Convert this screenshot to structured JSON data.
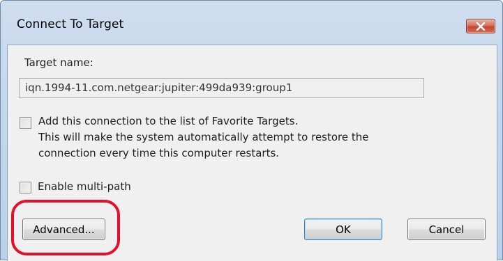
{
  "dialog": {
    "title": "Connect To Target",
    "target_name_label": "Target name:",
    "target_name_value": "iqn.1994-11.com.netgear:jupiter:499da939:group1",
    "favorite_checkbox": {
      "label": "Add this connection to the list of Favorite Targets.",
      "description_line1": "This will make the system automatically attempt to restore the",
      "description_line2": "connection every time this computer restarts.",
      "checked": false
    },
    "multipath_checkbox": {
      "label": "Enable multi-path",
      "checked": false
    },
    "buttons": {
      "advanced": "Advanced...",
      "ok": "OK",
      "cancel": "Cancel"
    }
  },
  "annotation": {
    "highlight_color": "#e2102a",
    "highlight_target": "advanced-button"
  },
  "icons": {
    "close": "close-icon"
  },
  "colors": {
    "title_bar": "#c5d7ec",
    "client_area": "#f0f0f0",
    "close_button": "#c84731"
  }
}
